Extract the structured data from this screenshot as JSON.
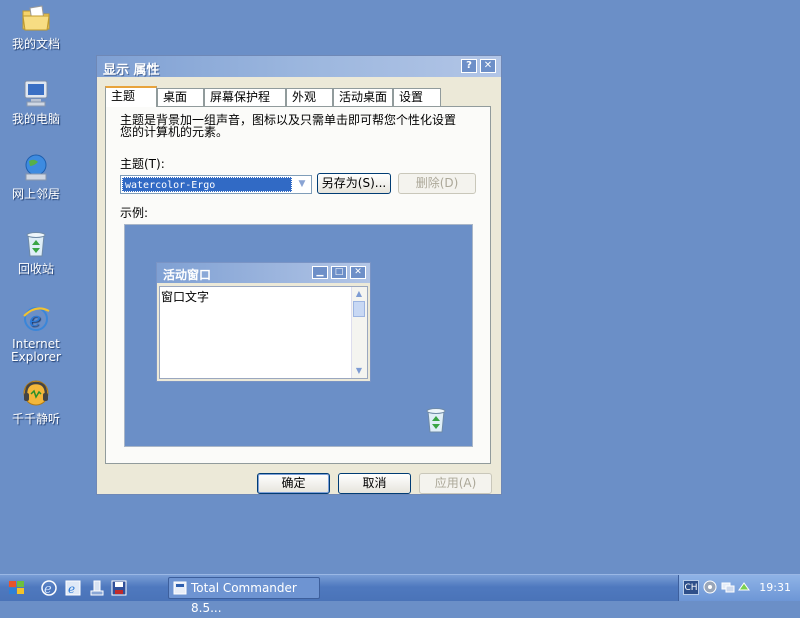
{
  "desktop": {
    "icons": [
      {
        "label": "我的文档",
        "icon": "folder-documents-icon"
      },
      {
        "label": "我的电脑",
        "icon": "computer-icon"
      },
      {
        "label": "网上邻居",
        "icon": "network-icon"
      },
      {
        "label": "回收站",
        "icon": "recycle-bin-icon"
      },
      {
        "label": "Internet Explorer",
        "icon": "internet-explorer-icon"
      },
      {
        "label": "千千静听",
        "icon": "music-player-icon"
      }
    ]
  },
  "dialog": {
    "title": "显示 属性",
    "help_glyph": "?",
    "close_glyph": "✕",
    "tabs": [
      {
        "label": "主题",
        "active": true
      },
      {
        "label": "桌面"
      },
      {
        "label": "屏幕保护程序"
      },
      {
        "label": "外观"
      },
      {
        "label": "活动桌面"
      },
      {
        "label": "设置"
      }
    ],
    "description": "主题是背景加一组声音，图标以及只需单击即可帮您个性化设置您的计算机的元素。",
    "theme_label": "主题(T):",
    "theme_value": "watercolor-Ergo",
    "save_as_label": "另存为(S)...",
    "delete_label": "删除(D)",
    "example_label": "示例:",
    "preview": {
      "window_title": "活动窗口",
      "window_text": "窗口文字",
      "min_glyph": "▁",
      "max_glyph": "□",
      "close_glyph": "✕"
    },
    "ok_label": "确定",
    "cancel_label": "取消",
    "apply_label": "应用(A)"
  },
  "taskbar": {
    "task_label": "Total Commander 8.5...",
    "language": "CH",
    "clock": "19:31"
  },
  "colors": {
    "desktop": "#6b8fc7",
    "title_gradient_start": "#7fa0d3",
    "active_tab_accent": "#e8a33b",
    "selection": "#316ac5"
  }
}
